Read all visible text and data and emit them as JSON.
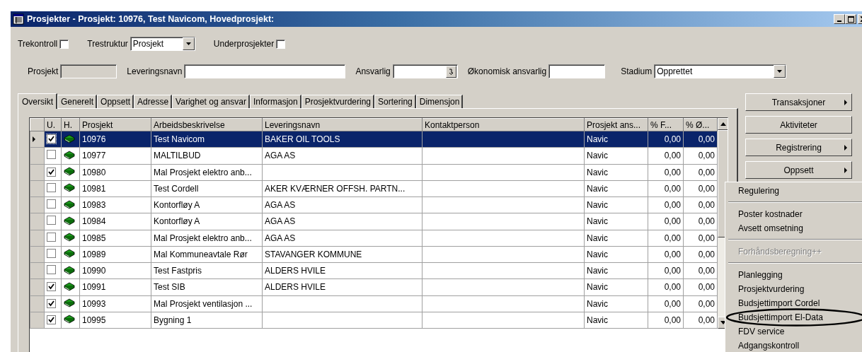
{
  "window": {
    "title": "Prosjekter - Prosjekt: 10976, Test Navicom, Hovedprosjekt:"
  },
  "filters": {
    "trekontroll": {
      "label": "Trekontroll",
      "checked": false
    },
    "trestruktur": {
      "label": "Trestruktur",
      "value": "Prosjekt"
    },
    "underprosjekter": {
      "label": "Underprosjekter",
      "checked": false
    }
  },
  "fields": [
    {
      "kind": "disabled",
      "label": "Prosjekt"
    },
    {
      "kind": "text",
      "label": "Leveringsnavn"
    },
    {
      "kind": "lookup",
      "label": "Ansvarlig"
    },
    {
      "kind": "text",
      "label": "Økonomisk ansvarlig"
    },
    {
      "kind": "select",
      "label": "Stadium",
      "value": "Opprettet"
    }
  ],
  "tabs": [
    {
      "label": "Oversikt",
      "selected": true
    },
    {
      "label": "Generelt",
      "selected": false
    },
    {
      "label": "Oppsett",
      "selected": false
    },
    {
      "label": "Adresse",
      "selected": false
    },
    {
      "label": "Varighet og ansvar",
      "selected": false
    },
    {
      "label": "Informasjon",
      "selected": false
    },
    {
      "label": "Prosjektvurdering",
      "selected": false
    },
    {
      "label": "Sortering",
      "selected": false
    },
    {
      "label": "Dimensjon",
      "selected": false
    }
  ],
  "table": {
    "columns": [
      "U.",
      "H.",
      "Prosjekt",
      "Arbeidsbeskrivelse",
      "Leveringsnavn",
      "Kontaktperson",
      "Prosjekt ans...",
      "% F...",
      "% Ø..."
    ],
    "rows": [
      {
        "selected": true,
        "checked": true,
        "cells": [
          "",
          "",
          "10976",
          "Test Navicom",
          "BAKER OIL TOOLS",
          "",
          "Navic",
          "0,00",
          "0,00"
        ]
      },
      {
        "selected": false,
        "checked": false,
        "cells": [
          "",
          "",
          "10977",
          "MALTILBUD",
          "AGA AS",
          "",
          "Navic",
          "0,00",
          "0,00"
        ]
      },
      {
        "selected": false,
        "checked": true,
        "cells": [
          "",
          "",
          "10980",
          "Mal Prosjekt elektro anb...",
          "",
          "",
          "Navic",
          "0,00",
          "0,00"
        ]
      },
      {
        "selected": false,
        "checked": false,
        "cells": [
          "",
          "",
          "10981",
          "Test Cordell",
          "AKER KVÆRNER OFFSH. PARTN...",
          "",
          "Navic",
          "0,00",
          "0,00"
        ]
      },
      {
        "selected": false,
        "checked": false,
        "cells": [
          "",
          "",
          "10983",
          "Kontorfløy A",
          "AGA AS",
          "",
          "Navic",
          "0,00",
          "0,00"
        ]
      },
      {
        "selected": false,
        "checked": false,
        "cells": [
          "",
          "",
          "10984",
          "Kontorfløy A",
          "AGA AS",
          "",
          "Navic",
          "0,00",
          "0,00"
        ]
      },
      {
        "selected": false,
        "checked": false,
        "cells": [
          "",
          "",
          "10985",
          "Mal Prosjekt elektro anb...",
          "AGA AS",
          "",
          "Navic",
          "0,00",
          "0,00"
        ]
      },
      {
        "selected": false,
        "checked": false,
        "cells": [
          "",
          "",
          "10989",
          "Mal Kommuneavtale Rør",
          "STAVANGER KOMMUNE",
          "",
          "Navic",
          "0,00",
          "0,00"
        ]
      },
      {
        "selected": false,
        "checked": false,
        "cells": [
          "",
          "",
          "10990",
          "Test Fastpris",
          "ALDERS HVILE",
          "",
          "Navic",
          "0,00",
          "0,00"
        ]
      },
      {
        "selected": false,
        "checked": true,
        "cells": [
          "",
          "",
          "10991",
          "Test SIB",
          "ALDERS HVILE",
          "",
          "Navic",
          "0,00",
          "0,00"
        ]
      },
      {
        "selected": false,
        "checked": true,
        "cells": [
          "",
          "",
          "10993",
          "Mal Prosjekt ventilasjon ...",
          "",
          "",
          "Navic",
          "0,00",
          "0,00"
        ]
      },
      {
        "selected": false,
        "checked": true,
        "cells": [
          "",
          "",
          "10995",
          "Bygning 1",
          "",
          "",
          "Navic",
          "0,00",
          "0,00"
        ]
      }
    ]
  },
  "side_buttons": [
    {
      "label": "Transaksjoner",
      "submenu": true
    },
    {
      "label": "Aktiviteter",
      "submenu": false
    },
    {
      "label": "Registrering",
      "submenu": true
    },
    {
      "label": "Oppsett",
      "submenu": true
    }
  ],
  "menu": {
    "items": [
      {
        "kind": "item",
        "label": "Regulering",
        "disabled": false
      },
      {
        "kind": "separator"
      },
      {
        "kind": "item",
        "label": "Poster kostnader",
        "disabled": false
      },
      {
        "kind": "item",
        "label": "Avsett omsetning",
        "disabled": false
      },
      {
        "kind": "separator"
      },
      {
        "kind": "item",
        "label": "Forhåndsberegning++",
        "disabled": true
      },
      {
        "kind": "separator"
      },
      {
        "kind": "item",
        "label": "Planlegging",
        "disabled": false
      },
      {
        "kind": "item",
        "label": "Prosjektvurdering",
        "disabled": false
      },
      {
        "kind": "item",
        "label": "Budsjettimport Cordel",
        "disabled": false
      },
      {
        "kind": "item",
        "label": "Budsjettimport El-Data",
        "disabled": false,
        "circled": true
      },
      {
        "kind": "item",
        "label": "FDV service",
        "disabled": false
      },
      {
        "kind": "item",
        "label": "Adgangskontroll",
        "disabled": false
      }
    ]
  }
}
